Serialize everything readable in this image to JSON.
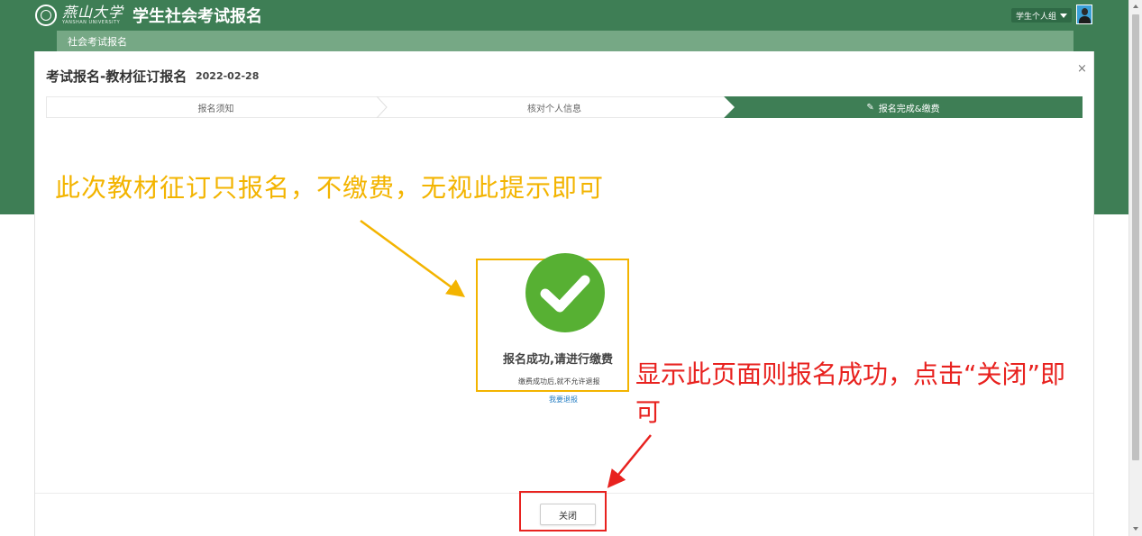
{
  "header": {
    "logo_cn": "燕山大学",
    "logo_en": "YANSHAN UNIVERSITY",
    "site_title": "学生社会考试报名",
    "user_menu_label": "学生个人组",
    "subnav_label": "社会考试报名"
  },
  "modal": {
    "title": "考试报名-教材征订报名",
    "date": "2022-02-28",
    "close_symbol": "×",
    "steps": [
      {
        "label": "报名须知",
        "active": false
      },
      {
        "label": "核对个人信息",
        "active": false
      },
      {
        "label": "报名完成&缴费",
        "active": true,
        "icon": "pencil-icon"
      }
    ],
    "success": {
      "title": "报名成功,请进行缴费",
      "note": "缴费成功后,就不允许退报",
      "refund_link": "我要退报"
    },
    "close_button": "关闭"
  },
  "annotations": {
    "yellow_text": "此次教材征订只报名，不缴费，无视此提示即可",
    "red_text": "显示此页面则报名成功，点击“关闭”即可",
    "yellow_color": "#f3b400",
    "red_color": "#e8221f"
  },
  "colors": {
    "brand_green": "#3e7e55",
    "subnav_green": "#76a885",
    "success_green": "#57b033",
    "link_blue": "#2a80c4"
  }
}
